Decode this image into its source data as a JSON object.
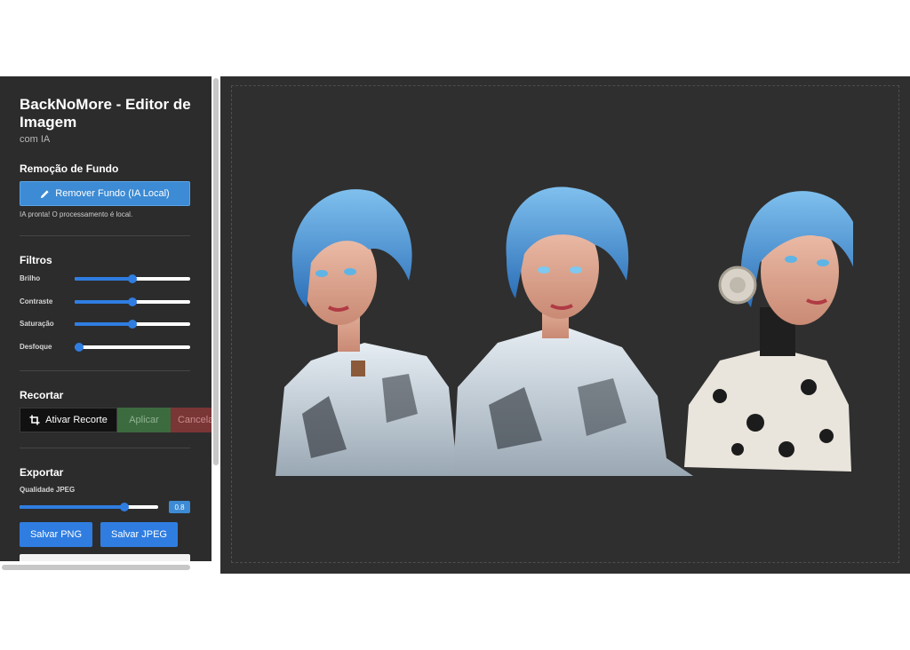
{
  "app": {
    "title": "BackNoMore - Editor de Imagem",
    "subtitle": "com IA"
  },
  "background_removal": {
    "section_title": "Remoção de Fundo",
    "button_label": "Remover Fundo (IA Local)",
    "button_icon": "pencil-icon",
    "status": "IA pronta! O processamento é local."
  },
  "filters": {
    "section_title": "Filtros",
    "sliders": [
      {
        "label": "Brilho",
        "value": 0.5
      },
      {
        "label": "Contraste",
        "value": 0.5
      },
      {
        "label": "Saturação",
        "value": 0.5
      },
      {
        "label": "Desfoque",
        "value": 0.0
      }
    ]
  },
  "crop": {
    "section_title": "Recortar",
    "activate_label": "Ativar Recorte",
    "activate_icon": "crop-icon",
    "apply_label": "Aplicar",
    "cancel_label": "Cancelar"
  },
  "export": {
    "section_title": "Exportar",
    "quality_label": "Qualidade JPEG",
    "quality_value": "0.8",
    "quality_fraction": 0.8,
    "save_png_label": "Salvar PNG",
    "save_jpeg_label": "Salvar JPEG"
  },
  "colors": {
    "accent": "#2f7de1",
    "sidebar_bg": "#2c2c2c",
    "canvas_bg": "#2f2f2f",
    "apply_bg": "#3c6b3f",
    "cancel_bg": "#7a3535"
  }
}
